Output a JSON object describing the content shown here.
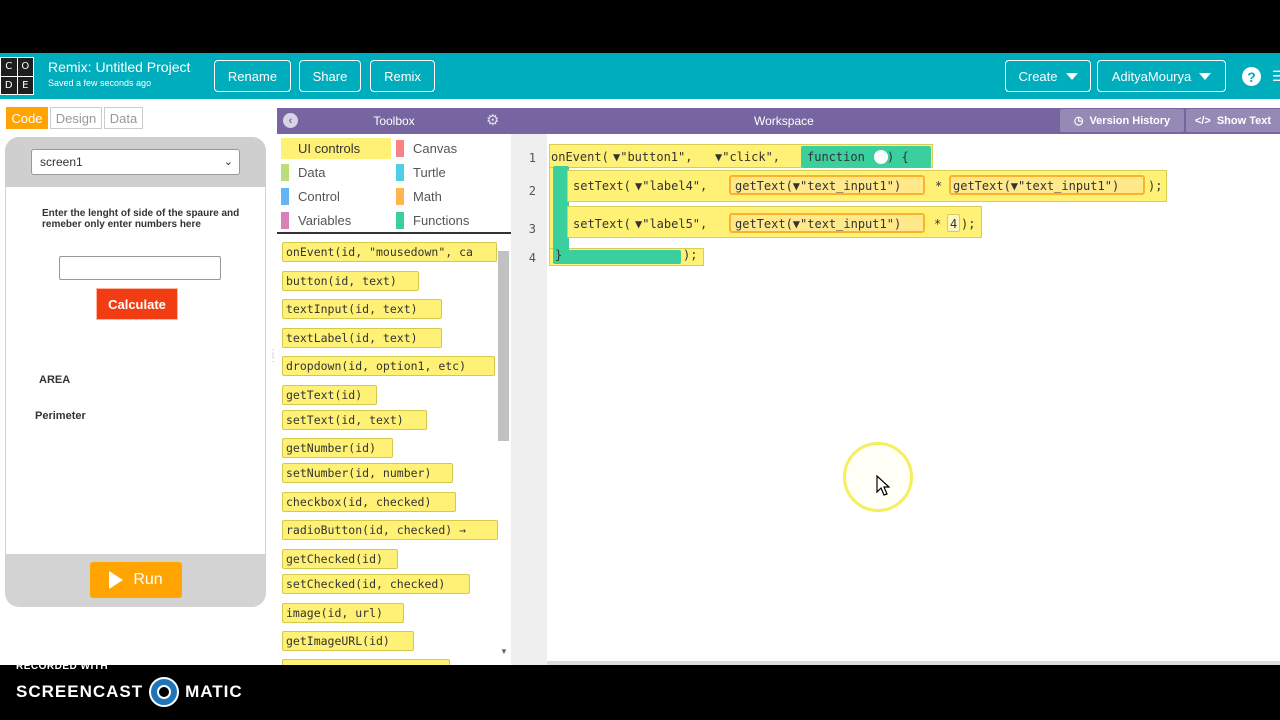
{
  "header": {
    "logo_letters": [
      "C",
      "O",
      "D",
      "E"
    ],
    "project_title": "Remix: Untitled Project",
    "saved_status": "Saved a few seconds ago",
    "rename_label": "Rename",
    "share_label": "Share",
    "remix_label": "Remix",
    "create_label": "Create",
    "user_label": "AdityaMourya",
    "help_glyph": "?",
    "menu_glyph": "☰",
    "accent_color": "#00adbc"
  },
  "left_tabs": [
    "Code",
    "Design",
    "Data"
  ],
  "app_preview": {
    "screen_select": "screen1",
    "instructions": "Enter the lenght of side of the spaure and remeber only enter numbers here",
    "input_value": "",
    "calculate_label": "Calculate",
    "area_label": "AREA",
    "perimeter_label": "Perimeter",
    "run_label": "Run"
  },
  "toolbox": {
    "title": "Toolbox",
    "categories": [
      {
        "label": "UI controls",
        "color": "#fff176"
      },
      {
        "label": "Canvas",
        "color": "#f78183"
      },
      {
        "label": "Data",
        "color": "#bcdd79"
      },
      {
        "label": "Turtle",
        "color": "#4dd0e1"
      },
      {
        "label": "Control",
        "color": "#64b5f6"
      },
      {
        "label": "Math",
        "color": "#ffb74d"
      },
      {
        "label": "Variables",
        "color": "#d880b8"
      },
      {
        "label": "Functions",
        "color": "#3bcf9d"
      }
    ],
    "blocks": [
      "onEvent(id, \"mousedown\", ca",
      "button(id, text)",
      "textInput(id, text)",
      "textLabel(id, text)",
      "dropdown(id, option1, etc)",
      "getText(id)",
      "setText(id, text)",
      "getNumber(id)",
      "setNumber(id, number)",
      "checkbox(id, checked)",
      "radioButton(id, checked) →",
      "getChecked(id)",
      "setChecked(id, checked)",
      "image(id, url)",
      "getImageURL(id)"
    ]
  },
  "workspace": {
    "title": "Workspace",
    "version_history_label": "Version History",
    "show_text_label": "Show Text",
    "line_numbers": [
      "1",
      "2",
      "3",
      "4"
    ],
    "code": {
      "l1_prefix": "onEvent(",
      "l1_arg1": "▼\"button1\",",
      "l1_arg2": "▼\"click\",",
      "l1_func": "function",
      "l1_suffix": ") {",
      "l2_prefix": "setText(",
      "l2_arg1": "▼\"label4\",",
      "l2_get1": "getText(▼\"text_input1\")",
      "l2_op": "*",
      "l2_get2": "getText(▼\"text_input1\")",
      "l2_suffix": ");",
      "l3_prefix": "setText(",
      "l3_arg1": "▼\"label5\",",
      "l3_get1": "getText(▼\"text_input1\")",
      "l3_op": "*",
      "l3_num": "4",
      "l3_suffix": ");",
      "l4_brace": "}",
      "l4_suffix": ");"
    }
  },
  "watermark": {
    "recorded": "RECORDED WITH",
    "brand_left": "SCREENCAST",
    "brand_right": "MATIC"
  }
}
